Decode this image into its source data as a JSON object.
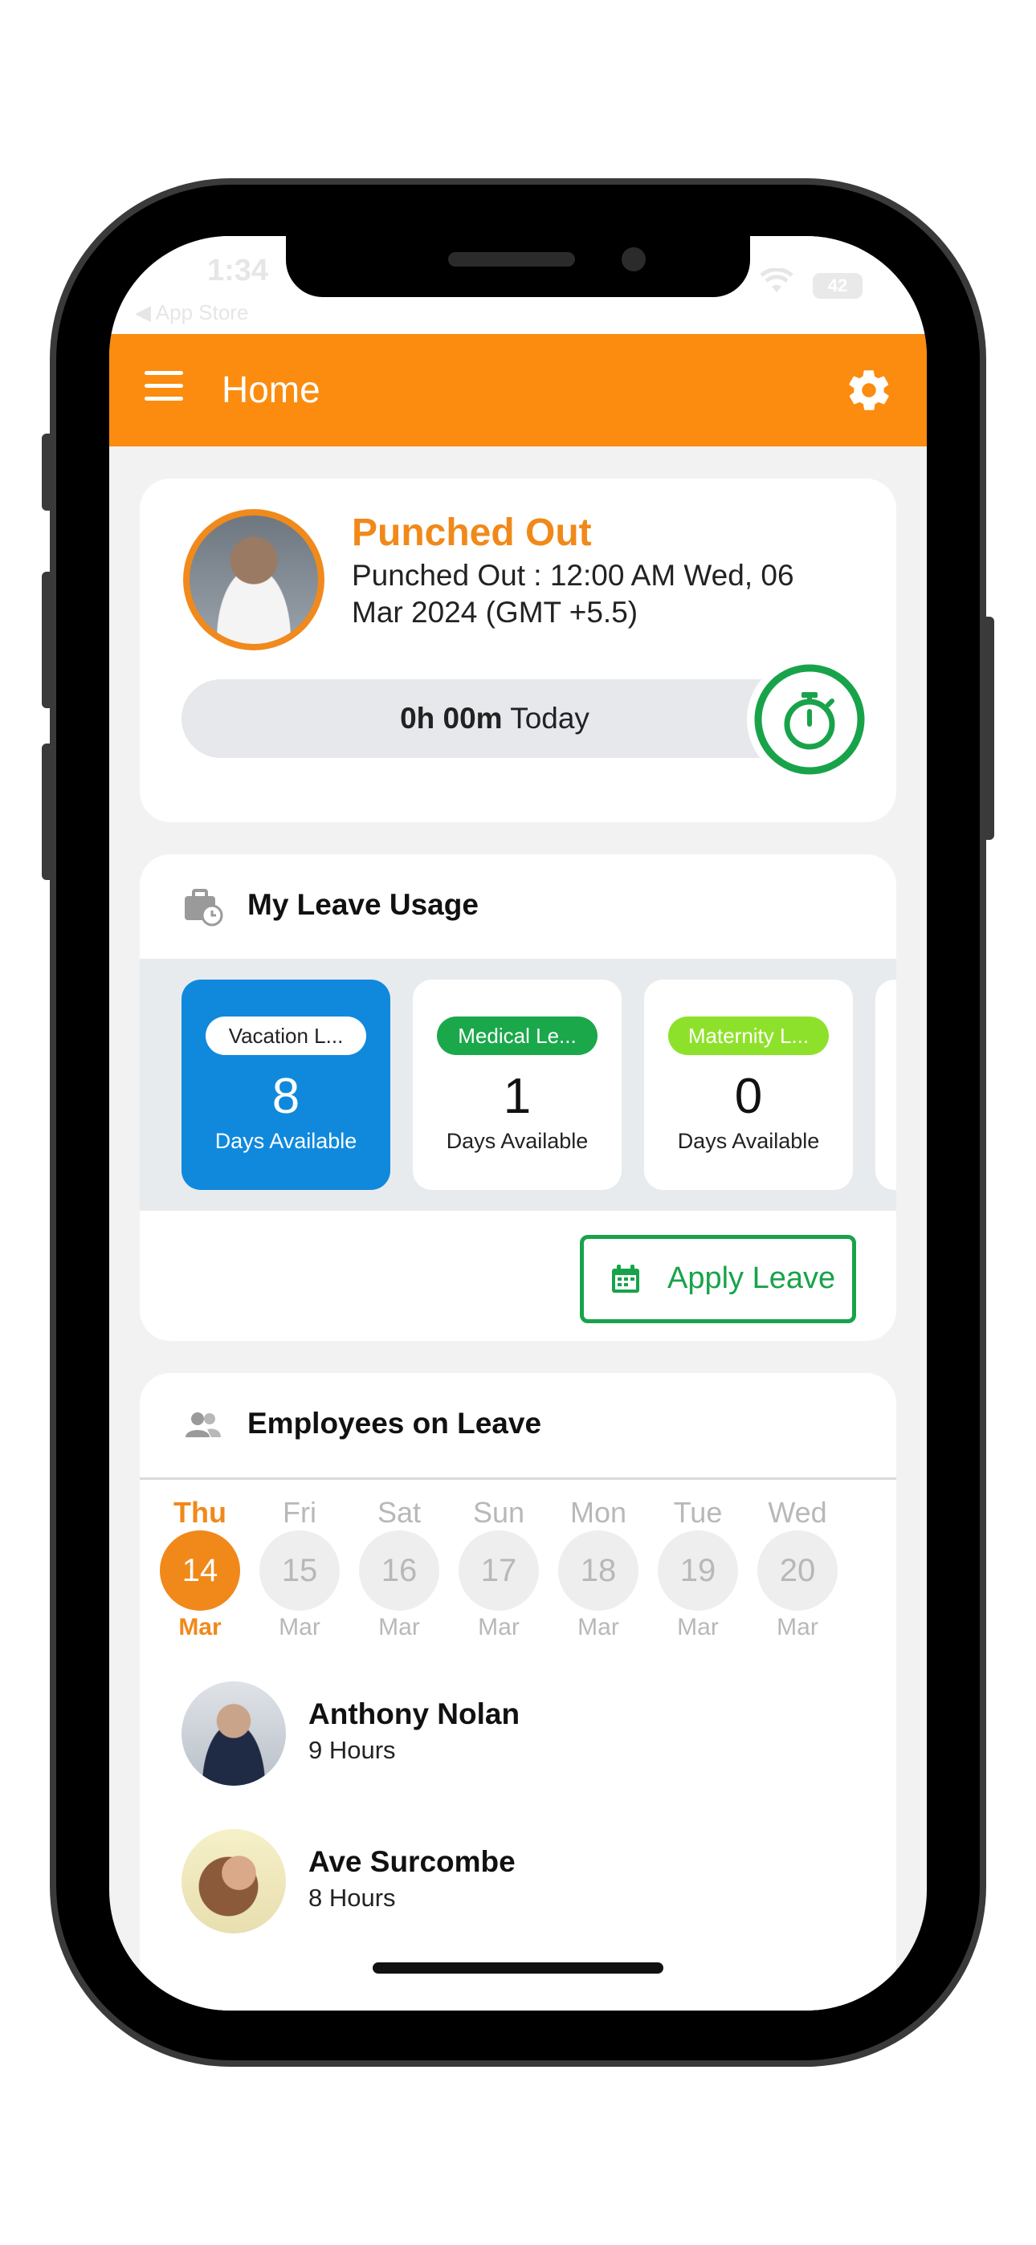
{
  "status_bar": {
    "time": "1:34",
    "back_label": "◀ App Store",
    "battery": "42"
  },
  "header": {
    "title": "Home",
    "menu_icon": "hamburger-menu-icon",
    "settings_icon": "gear-icon",
    "background": "#fb8c0f"
  },
  "punch": {
    "status": "Punched Out",
    "detail": "Punched Out : 12:00 AM Wed, 06 Mar 2024 (GMT +5.5)",
    "duration": "0h 00m",
    "duration_suffix": "Today",
    "accent": "#f0891a"
  },
  "leave_usage": {
    "title": "My Leave Usage",
    "tiles": [
      {
        "label": "Vacation L...",
        "count": "8",
        "sub": "Days Available",
        "chip_bg": "#ffffff",
        "chip_fg": "#222222",
        "active": true
      },
      {
        "label": "Medical Le...",
        "count": "1",
        "sub": "Days Available",
        "chip_bg": "#1aa84b",
        "chip_fg": "#ffffff",
        "active": false
      },
      {
        "label": "Maternity L...",
        "count": "0",
        "sub": "Days Available",
        "chip_bg": "#8ee12a",
        "chip_fg": "#ffffff",
        "active": false
      }
    ],
    "apply_label": "Apply Leave"
  },
  "employees_on_leave": {
    "title": "Employees on Leave",
    "days": [
      {
        "name": "Thu",
        "date": "14",
        "month": "Mar",
        "active": true
      },
      {
        "name": "Fri",
        "date": "15",
        "month": "Mar",
        "active": false
      },
      {
        "name": "Sat",
        "date": "16",
        "month": "Mar",
        "active": false
      },
      {
        "name": "Sun",
        "date": "17",
        "month": "Mar",
        "active": false
      },
      {
        "name": "Mon",
        "date": "18",
        "month": "Mar",
        "active": false
      },
      {
        "name": "Tue",
        "date": "19",
        "month": "Mar",
        "active": false
      },
      {
        "name": "Wed",
        "date": "20",
        "month": "Mar",
        "active": false
      }
    ],
    "employees": [
      {
        "name": "Anthony Nolan",
        "hours": "9 Hours"
      },
      {
        "name": "Ave Surcombe",
        "hours": "8 Hours"
      }
    ]
  }
}
